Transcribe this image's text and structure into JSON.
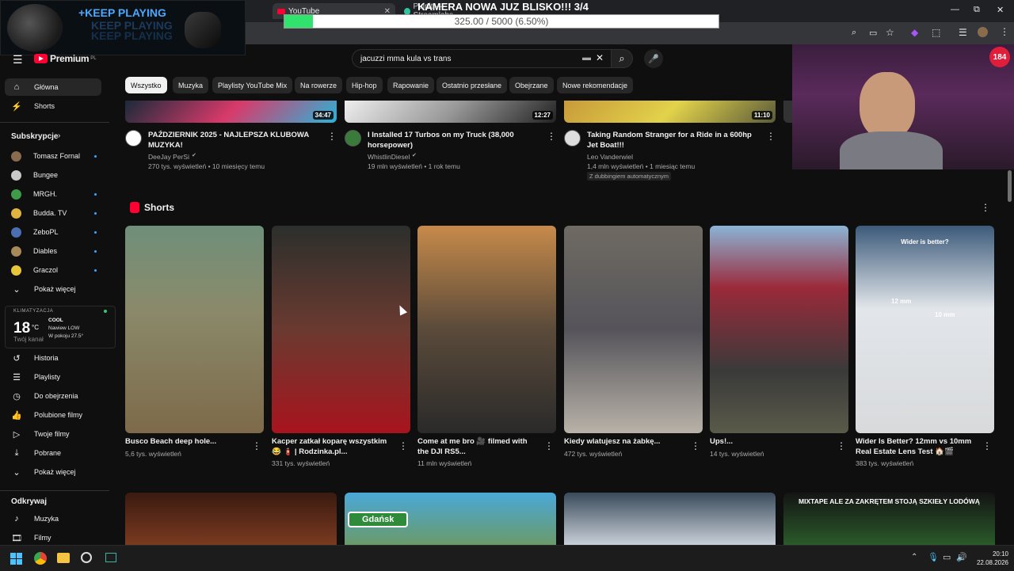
{
  "overlay": {
    "title": "KAMERA NOWA JUZ BLISKO!!! 3/4",
    "progress_text": "325.00 / 5000 (6.50%)",
    "progress_fraction": 0.065,
    "keep_playing": "+KEEP PLAYING",
    "keep_playing_echo": "KEEP PLAYING"
  },
  "browser": {
    "tabs": [
      {
        "label": "YouTube"
      },
      {
        "label": "Pulpit — Streamlabs"
      }
    ],
    "win": {
      "minimize": "—",
      "restore": "⧉",
      "close": "✕"
    }
  },
  "yt": {
    "brand": "Premium",
    "brand_sup": "PL",
    "search_value": "jacuzzi mma kula vs trans",
    "chips": [
      "Wszystko",
      "Muzyka",
      "Playlisty YouTube Mix",
      "Na rowerze",
      "Hip-hop",
      "Rapowanie",
      "Ostatnio przesłane",
      "Obejrzane",
      "Nowe rekomendacje"
    ],
    "nav_main": [
      {
        "label": "Główna",
        "icon": "home-icon"
      },
      {
        "label": "Shorts",
        "icon": "shorts-icon"
      }
    ],
    "subs_heading": "Subskrypcje",
    "subs": [
      {
        "label": "Tomasz Fornal",
        "color": "#8a6b4e",
        "dot": true
      },
      {
        "label": "Bungee",
        "color": "#c9c9c9",
        "dot": false
      },
      {
        "label": "MRGH.",
        "color": "#3d9b4a",
        "dot": true
      },
      {
        "label": "Budda. TV",
        "color": "#e0b341",
        "dot": true
      },
      {
        "label": "ZeboPL",
        "color": "#4b6fb0",
        "dot": true
      },
      {
        "label": "Diables",
        "color": "#a88a5a",
        "dot": true
      },
      {
        "label": "Graczol",
        "color": "#e7c53a",
        "dot": true
      }
    ],
    "show_more": "Pokaż więcej",
    "weather": {
      "label": "KLIMATYZACJA",
      "temp": "18",
      "unit": "°C",
      "mode": "COOL",
      "fan": "Nawiew LOW",
      "room": "W pokoju 27.5°",
      "under": "Twój kanał"
    },
    "nav_you": [
      {
        "label": "Historia",
        "icon": "history-icon"
      },
      {
        "label": "Playlisty",
        "icon": "playlist-icon"
      },
      {
        "label": "Do obejrzenia",
        "icon": "watch-later-icon"
      },
      {
        "label": "Polubione filmy",
        "icon": "like-icon"
      },
      {
        "label": "Twoje filmy",
        "icon": "your-videos-icon"
      },
      {
        "label": "Pobrane",
        "icon": "download-icon"
      },
      {
        "label": "Pokaż więcej",
        "icon": "chevron-down-icon"
      }
    ],
    "explore_heading": "Odkrywaj",
    "nav_explore": [
      {
        "label": "Muzyka",
        "icon": "music-icon"
      },
      {
        "label": "Filmy",
        "icon": "film-icon"
      }
    ],
    "videos": [
      {
        "title": "PAŹDZIERNIK 2025 - NAJLEPSZA KLUBOWA MUZYKA!",
        "channel": "DeeJay PerSi",
        "meta": "270 tys. wyświetleń • 10 miesięcy temu",
        "duration": "34:47",
        "verified": true
      },
      {
        "title": "I Installed 17 Turbos on my Truck (38,000 horsepower)",
        "channel": "WhistlinDiesel",
        "meta": "19 mln wyświetleń • 1 rok temu",
        "duration": "12:27",
        "verified": true
      },
      {
        "title": "Taking Random Stranger for a Ride in a 600hp Jet Boat!!!",
        "channel": "Leo Vanderwiel",
        "meta": "1,4 mln wyświetleń • 1 miesiąc temu",
        "duration": "11:10",
        "verified": false,
        "badge": "Z dubbingiem automatycznym"
      }
    ],
    "shorts_heading": "Shorts",
    "shorts": [
      {
        "title": "Busco Beach deep hole...",
        "views": "5,6 tys. wyświetleń",
        "bg": "linear-gradient(180deg,#6f8f7a 0%,#8a8a6a 40%,#7d6a4a 100%)"
      },
      {
        "title": "Kacper zatkał koparę wszystkim 😂 🧯 | Rodzinka.pl...",
        "views": "331 tys. wyświetleń",
        "bg": "linear-gradient(180deg,#2b2f2c 0%,#6a3a30 50%,#a8141e 100%)"
      },
      {
        "title": "Come at me bro 🎥 filmed with the DJI RS5...",
        "views": "11 mln wyświetleń",
        "bg": "linear-gradient(180deg,#c78a4a 0%,#5a4a3a 50%,#2a2a2a 100%)"
      },
      {
        "title": "Kiedy wlatujesz na żabkę...",
        "views": "472 tys. wyświetleń",
        "bg": "linear-gradient(180deg,#6f6a62 0%,#55545a 50%,#b8b2a8 100%)"
      },
      {
        "title": "Ups!...",
        "views": "14 tys. wyświetleń",
        "bg": "linear-gradient(180deg,#8bb4d6 0%,#9a2a3a 30%,#3a3a3a 70%,#5a5a4a 100%)"
      },
      {
        "title": "Wider Is Better? 12mm vs 10mm Real Estate Lens Test 🏠🎬",
        "views": "383 tys. wyświetleń",
        "bg": "linear-gradient(180deg,#3c5a7a 0%,#e2e6ea 40%,#d8dadc 100%)",
        "overlay_text": "Wider is better?",
        "l1": "12 mm",
        "l2": "10 mm"
      }
    ],
    "bottom_thumbs": [
      {
        "bg": "linear-gradient(180deg,#3a1a10,#7a3a20)"
      },
      {
        "bg": "linear-gradient(180deg,#4aa8d8,#6a9a6a)",
        "sign": "Gdańsk"
      },
      {
        "bg": "linear-gradient(180deg,#3a4a5a,#c8d0d8)"
      },
      {
        "bg": "linear-gradient(180deg,#141414,#2a5a2a)",
        "caption": "MIXTAPE ALE ZA ZAKRĘTEM STOJĄ SZKIEŁY LODÓWĄ"
      }
    ]
  },
  "taskbar": {
    "time": "20:10",
    "date": "22.08.2026"
  },
  "colors": {
    "accent_red": "#ff0033",
    "chip_bg": "#272727",
    "bg": "#0f0f0f"
  }
}
